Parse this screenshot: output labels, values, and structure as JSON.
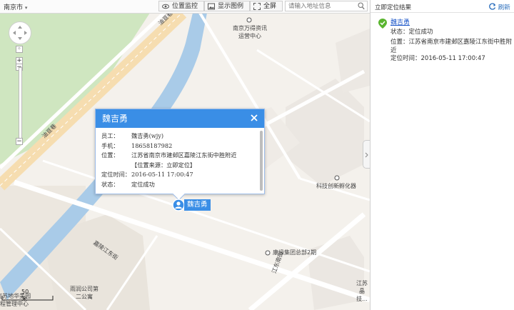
{
  "toolbar": {
    "city": "南京市",
    "btn_monitor": "位置监控",
    "btn_legend": "显示图例",
    "btn_fullscreen": "全屏",
    "search_placeholder": "请输入地址信息"
  },
  "map": {
    "labels": {
      "wanderzi": "南京万得资讯运营中心",
      "keji": "科技创新孵化器",
      "kangyuan": "康缘集团总部2期",
      "yurun": "雨润公司第二公寓",
      "jiangsu": "江苏晶技...",
      "road_jialing": "嘉陵江东街",
      "road_jiangdong": "嘉陵江东街",
      "road_jiangdong2": "江东南街",
      "road_dingmao": "油亘巷",
      "bottom_left_1": "[苏地华美园",
      "bottom_left_2": "程管理中心"
    },
    "scale_label": "50 米"
  },
  "popup": {
    "title": "魏吉勇",
    "fields": [
      {
        "k": "员工：",
        "v": "魏吉勇(wjy)"
      },
      {
        "k": "手机：",
        "v": "18658187982"
      },
      {
        "k": "位置：",
        "v": "江苏省南京市建邺区嘉陵江东街中胜附近"
      },
      {
        "k": "",
        "v": "【位置来源：立即定位】"
      },
      {
        "k": "定位时间：",
        "v": "2016-05-11 17:00:47"
      },
      {
        "k": "状态：",
        "v": "定位成功"
      }
    ]
  },
  "marker": {
    "label": "魏吉勇"
  },
  "sidebar": {
    "title": "立即定位结果",
    "refresh": "刷新",
    "result": {
      "name": "魏吉勇",
      "status": "状态：定位成功",
      "location": "位置：江苏省南京市建邺区嘉陵江东街中胜附近",
      "time": "定位时间：2016-05-11 17:00:47"
    }
  },
  "colors": {
    "accent": "#3a8ee6",
    "river": "#a9cbe8",
    "park": "#cfe6c0",
    "road": "#ffffff",
    "road_major": "#f8e6a8",
    "success": "#5ab52f"
  }
}
